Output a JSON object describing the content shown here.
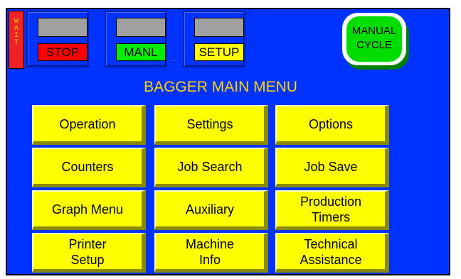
{
  "status": {
    "wait_letters": [
      "W",
      "A",
      "I",
      "T"
    ]
  },
  "modes": [
    {
      "label": "STOP",
      "color": "#ff0000"
    },
    {
      "label": "MANL",
      "color": "#00ee00"
    },
    {
      "label": "SETUP",
      "color": "#ffff00"
    }
  ],
  "manual_cycle": {
    "line1": "MANUAL",
    "line2": "CYCLE"
  },
  "title": "BAGGER MAIN MENU",
  "menu": [
    {
      "line1": "Operation",
      "line2": ""
    },
    {
      "line1": "Settings",
      "line2": ""
    },
    {
      "line1": "Options",
      "line2": ""
    },
    {
      "line1": "Counters",
      "line2": ""
    },
    {
      "line1": "Job Search",
      "line2": ""
    },
    {
      "line1": "Job Save",
      "line2": ""
    },
    {
      "line1": "Graph Menu",
      "line2": ""
    },
    {
      "line1": "Auxiliary",
      "line2": ""
    },
    {
      "line1": "Production",
      "line2": "Timers"
    },
    {
      "line1": "Printer",
      "line2": "Setup"
    },
    {
      "line1": "Machine",
      "line2": "Info"
    },
    {
      "line1": "Technical",
      "line2": "Assistance"
    }
  ]
}
